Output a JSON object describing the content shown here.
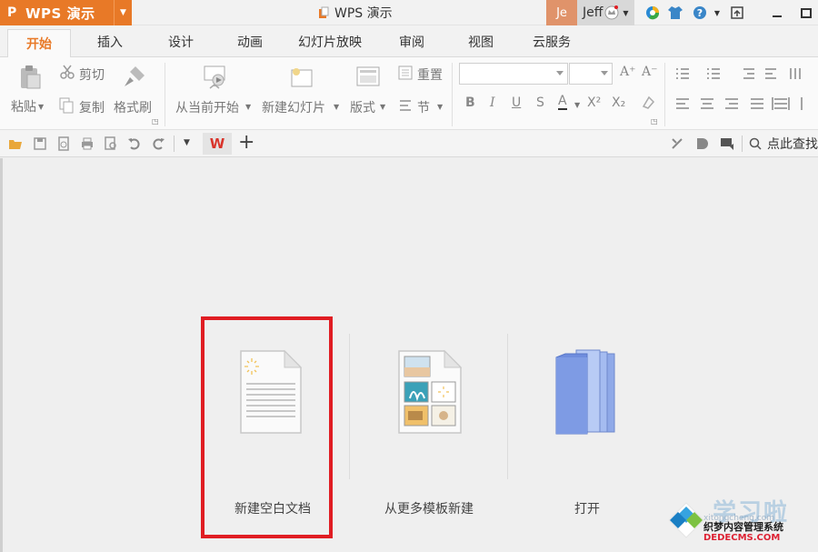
{
  "titlebar": {
    "app_name": "WPS 演示",
    "app_logo": "P",
    "doc_title": "WPS 演示",
    "avatar_text": "Je",
    "username": "Jeff"
  },
  "tabs": [
    "开始",
    "插入",
    "设计",
    "动画",
    "幻灯片放映",
    "审阅",
    "视图",
    "云服务"
  ],
  "active_tab": "开始",
  "ribbon": {
    "paste": "粘贴",
    "cut": "剪切",
    "copy": "复制",
    "format_painter": "格式刷",
    "play_from_current": "从当前开始",
    "new_slide": "新建幻灯片",
    "layout": "版式",
    "reset": "重置",
    "section": "节",
    "bold": "B",
    "italic": "I",
    "underline": "U",
    "strike": "S",
    "font_color": "A",
    "superscript": "X²",
    "subscript": "X₂",
    "grow": "A⁺",
    "shrink": "A⁻"
  },
  "quickbar": {
    "wps_logo": "W",
    "add": "+",
    "search": "点此查找"
  },
  "start_options": [
    {
      "label": "新建空白文档"
    },
    {
      "label": "从更多模板新建"
    },
    {
      "label": "打开"
    }
  ],
  "watermark": {
    "line1": "学习啦",
    "line2": "织梦内容管理系统",
    "line3": "DEDECMS.COM",
    "line4": "xitongcheng.com"
  },
  "colors": {
    "accent": "#e87927",
    "highlight": "#e01d23"
  }
}
